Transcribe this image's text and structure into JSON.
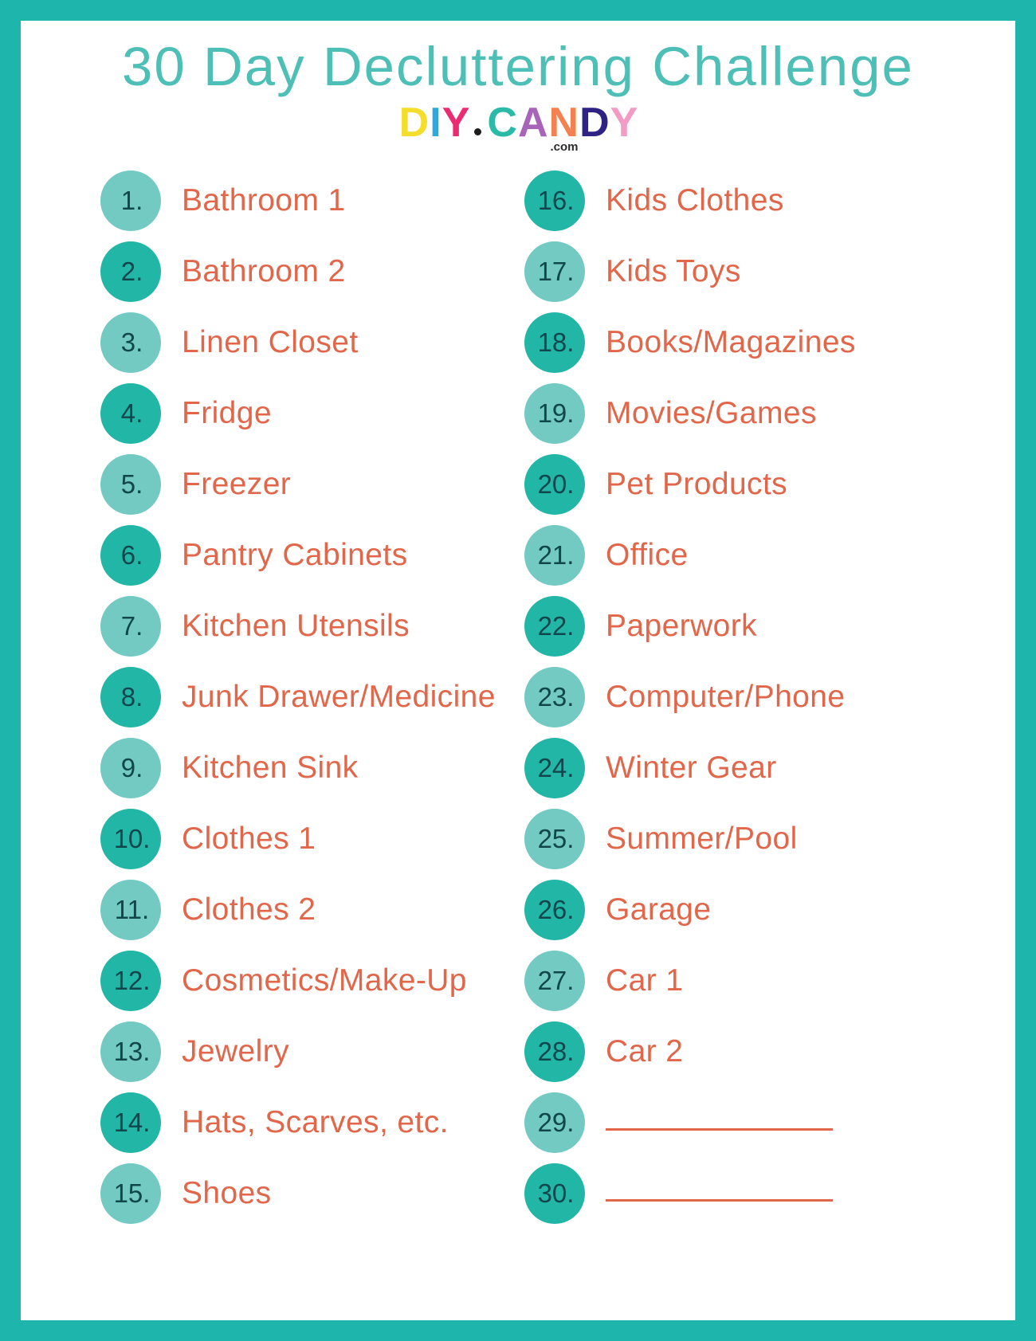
{
  "header": {
    "title": "30 Day Decluttering Challenge",
    "logo": {
      "letters": [
        "D",
        "I",
        "Y",
        "C",
        "A",
        "N",
        "D",
        "Y"
      ],
      "dot": "·",
      "domain_suffix": ".com"
    }
  },
  "colors": {
    "border_teal": "#1DB5AC",
    "title_teal": "#4DBFB7",
    "badge_light": "#72CAC3",
    "badge_dark": "#22B6A7",
    "badge_number": "#10464C",
    "item_text_coral": "#E2674A",
    "page_background": "#FFFFFF"
  },
  "list": {
    "left_column": [
      {
        "number": "1.",
        "label": "Bathroom 1",
        "shade": "light",
        "blank": false
      },
      {
        "number": "2.",
        "label": "Bathroom 2",
        "shade": "dark",
        "blank": false
      },
      {
        "number": "3.",
        "label": "Linen Closet",
        "shade": "light",
        "blank": false
      },
      {
        "number": "4.",
        "label": "Fridge",
        "shade": "dark",
        "blank": false
      },
      {
        "number": "5.",
        "label": "Freezer",
        "shade": "light",
        "blank": false
      },
      {
        "number": "6.",
        "label": "Pantry Cabinets",
        "shade": "dark",
        "blank": false
      },
      {
        "number": "7.",
        "label": "Kitchen Utensils",
        "shade": "light",
        "blank": false
      },
      {
        "number": "8.",
        "label": "Junk Drawer/Medicine",
        "shade": "dark",
        "blank": false
      },
      {
        "number": "9.",
        "label": "Kitchen Sink",
        "shade": "light",
        "blank": false
      },
      {
        "number": "10.",
        "label": "Clothes 1",
        "shade": "dark",
        "blank": false
      },
      {
        "number": "11.",
        "label": "Clothes 2",
        "shade": "light",
        "blank": false
      },
      {
        "number": "12.",
        "label": "Cosmetics/Make-Up",
        "shade": "dark",
        "blank": false
      },
      {
        "number": "13.",
        "label": "Jewelry",
        "shade": "light",
        "blank": false
      },
      {
        "number": "14.",
        "label": "Hats, Scarves, etc.",
        "shade": "dark",
        "blank": false
      },
      {
        "number": "15.",
        "label": "Shoes",
        "shade": "light",
        "blank": false
      }
    ],
    "right_column": [
      {
        "number": "16.",
        "label": "Kids Clothes",
        "shade": "dark",
        "blank": false
      },
      {
        "number": "17.",
        "label": "Kids Toys",
        "shade": "light",
        "blank": false
      },
      {
        "number": "18.",
        "label": "Books/Magazines",
        "shade": "dark",
        "blank": false
      },
      {
        "number": "19.",
        "label": "Movies/Games",
        "shade": "light",
        "blank": false
      },
      {
        "number": "20.",
        "label": "Pet Products",
        "shade": "dark",
        "blank": false
      },
      {
        "number": "21.",
        "label": "Office",
        "shade": "light",
        "blank": false
      },
      {
        "number": "22.",
        "label": "Paperwork",
        "shade": "dark",
        "blank": false
      },
      {
        "number": "23.",
        "label": "Computer/Phone",
        "shade": "light",
        "blank": false
      },
      {
        "number": "24.",
        "label": "Winter Gear",
        "shade": "dark",
        "blank": false
      },
      {
        "number": "25.",
        "label": "Summer/Pool",
        "shade": "light",
        "blank": false
      },
      {
        "number": "26.",
        "label": "Garage",
        "shade": "dark",
        "blank": false
      },
      {
        "number": "27.",
        "label": "Car 1",
        "shade": "light",
        "blank": false
      },
      {
        "number": "28.",
        "label": "Car 2",
        "shade": "dark",
        "blank": false
      },
      {
        "number": "29.",
        "label": "",
        "shade": "light",
        "blank": true
      },
      {
        "number": "30.",
        "label": "",
        "shade": "dark",
        "blank": true
      }
    ]
  }
}
